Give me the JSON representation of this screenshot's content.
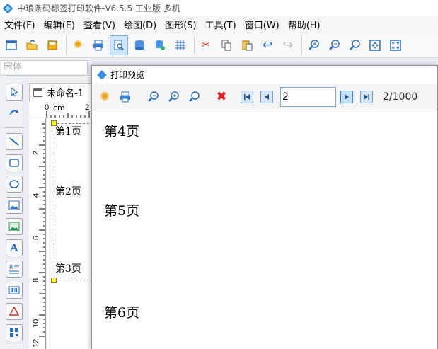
{
  "app": {
    "title": "中琅条码标签打印软件-V6.5.5 工业版 多机"
  },
  "menu": [
    "文件(F)",
    "编辑(E)",
    "查看(V)",
    "绘图(D)",
    "图形(S)",
    "工具(T)",
    "窗口(W)",
    "帮助(H)"
  ],
  "toolbar_icons": [
    "new-icon",
    "open-icon",
    "save-icon",
    "settings-icon",
    "print-icon",
    "print-preview-icon",
    "database-icon",
    "database-settings-icon",
    "grid-icon",
    "cut-icon",
    "copy-icon",
    "paste-icon",
    "undo-icon",
    "redo-icon",
    "zoom-in-icon",
    "zoom-out-icon",
    "zoom-actual-icon",
    "fit-page-icon",
    "fit-width-icon"
  ],
  "fontbar": {
    "font_name": "宋体"
  },
  "document": {
    "tab_label": "未命名-1"
  },
  "ruler": {
    "unit": "cm",
    "h_labels": [
      "0",
      "2"
    ],
    "v_labels": [
      "2",
      "4",
      "6",
      "8",
      "10",
      "12"
    ]
  },
  "canvas": {
    "pages": [
      "第1页",
      "第2页",
      "第3页"
    ]
  },
  "preview": {
    "title": "打印预览",
    "current_page": "2",
    "page_count": "2/1000",
    "pages": [
      "第4页",
      "第5页",
      "第6页"
    ]
  },
  "colors": {
    "accent": "#2f7fd1",
    "handle": "#ffff00",
    "close_red": "#e02020"
  }
}
